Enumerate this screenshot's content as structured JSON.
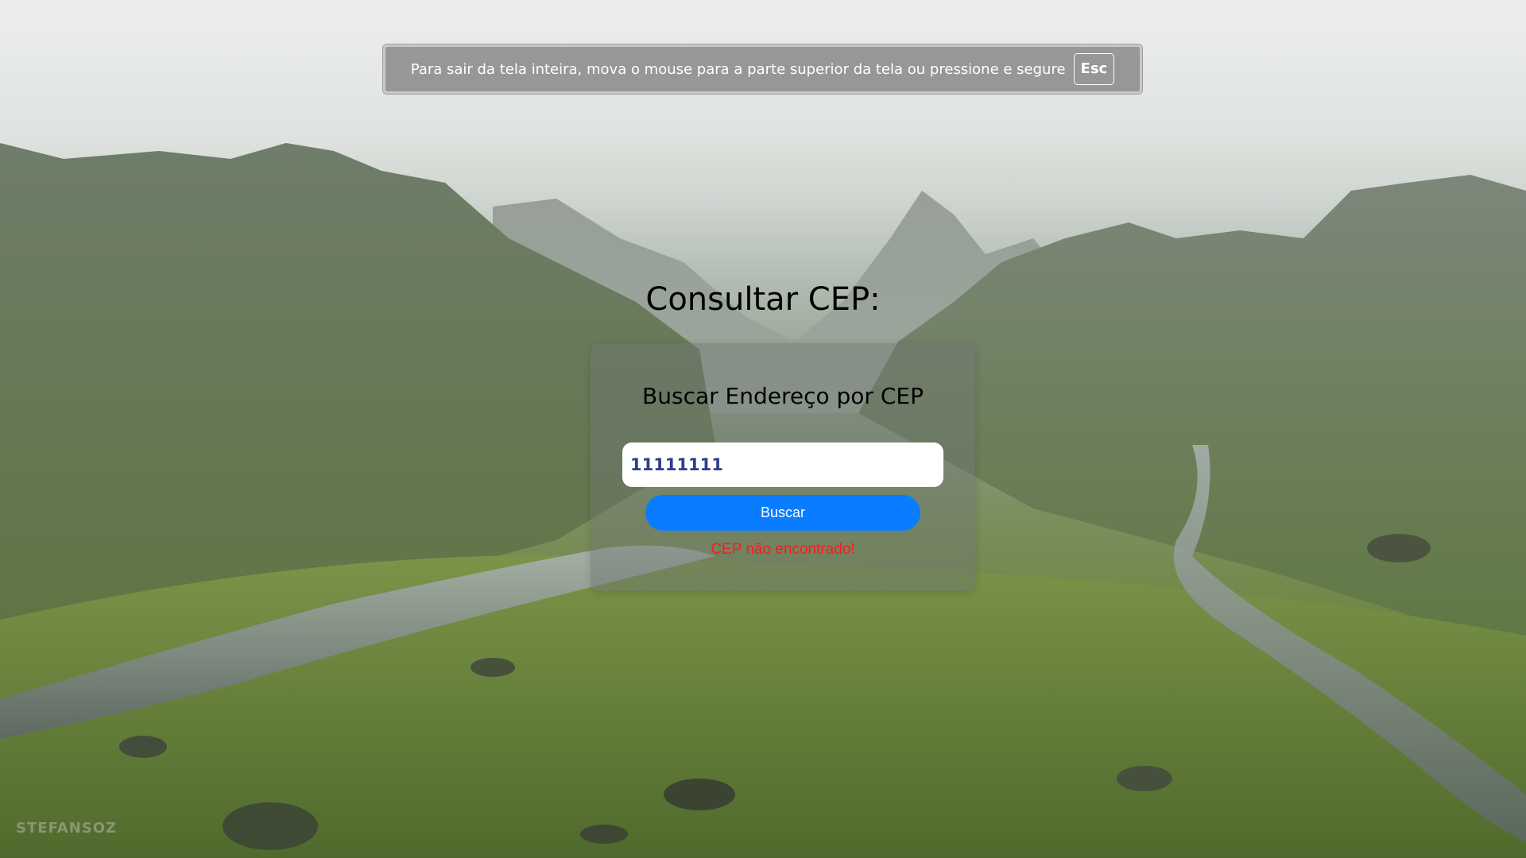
{
  "fullscreen_notice": {
    "message": "Para sair da tela inteira, mova o mouse para a parte superior da tela ou pressione e segure",
    "key_label": "Esc"
  },
  "page": {
    "title": "Consultar CEP:"
  },
  "search_card": {
    "title": "Buscar Endereço por CEP",
    "cep_input_value": "11111111",
    "search_button_label": "Buscar",
    "error_message": "CEP não encontrado!"
  },
  "background": {
    "description_icon": "mountain-valley-landscape",
    "watermark_text": "STEFANSOZ"
  },
  "colors": {
    "button_accent": "#0a7cff",
    "error": "#ff1a1a",
    "input_text": "#2f3d8a"
  }
}
